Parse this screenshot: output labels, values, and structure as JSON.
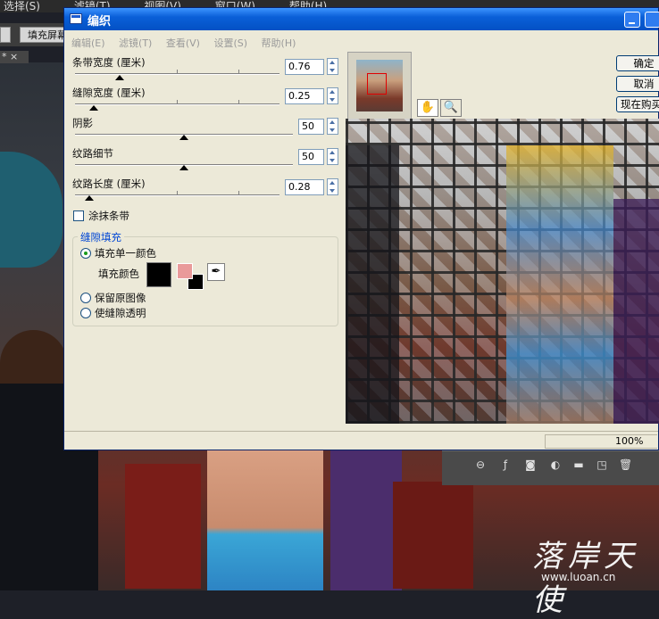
{
  "app_menu": [
    "选择(S)",
    "滤镜(T)",
    "视图(V)",
    "窗口(W)",
    "帮助(H)"
  ],
  "toolbar": {
    "fill_screen_label": "填充屏幕"
  },
  "doc_tab": {
    "label": "* ×"
  },
  "dialog": {
    "title": "编织",
    "menu": [
      "编辑(E)",
      "滤镜(T)",
      "查看(V)",
      "设置(S)",
      "帮助(H)"
    ],
    "params": {
      "strip_width": {
        "label": "条带宽度 (厘米)",
        "value": "0.76",
        "slider_fraction": 0.22
      },
      "gap_width": {
        "label": "缝隙宽度 (厘米)",
        "value": "0.25",
        "slider_fraction": 0.09
      },
      "shadow": {
        "label": "阴影",
        "value": "50",
        "slider_fraction": 0.5
      },
      "texture_detail": {
        "label": "纹路细节",
        "value": "50",
        "slider_fraction": 0.5
      },
      "texture_length": {
        "label": "纹路长度 (厘米)",
        "value": "0.28",
        "slider_fraction": 0.07
      }
    },
    "smear_strips": {
      "label": "涂抹条带",
      "checked": false
    },
    "gap_fill": {
      "title": "缝隙填充",
      "option_single_color": "填充单一颜色",
      "fill_color_label": "填充颜色",
      "option_keep_image": "保留原图像",
      "option_transparent": "使缝隙透明",
      "selected": "single_color",
      "fill_color": "#000000",
      "swatch_fg": "#e99a9a",
      "swatch_bg": "#000000"
    },
    "buttons": {
      "ok": "确定",
      "cancel": "取消",
      "buy": "现在购买"
    },
    "zoom": "100%"
  },
  "watermark": {
    "text": "落岸天使",
    "url": "www.luoan.cn"
  }
}
